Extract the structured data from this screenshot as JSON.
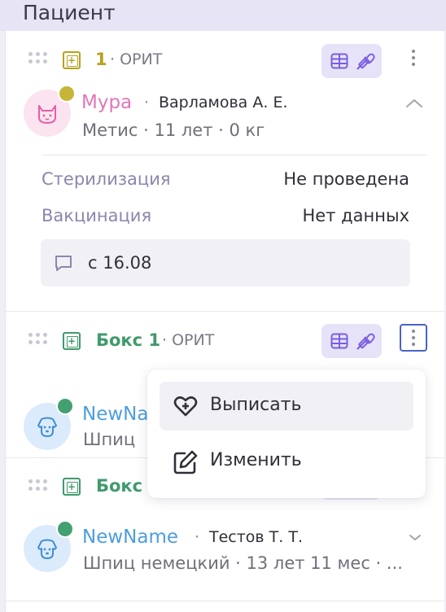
{
  "header": {
    "title": "Пациент"
  },
  "cards": [
    {
      "box_number": "1",
      "department": "ОРИТ",
      "box_color": "#b5a21e",
      "pet_name": "Мура",
      "pet_name_color": "#e276b8",
      "separator": "·",
      "owner": "Варламова А. Е.",
      "pet_info": "Метис · 11 лет · 0 кг",
      "status_color": "#c7b53a",
      "avatar": "cat-icon",
      "expanded": true,
      "details": [
        {
          "label": "Стерилизация",
          "value": "Не проведена"
        },
        {
          "label": "Вакцинация",
          "value": "Нет данных"
        }
      ],
      "note": "с 16.08"
    },
    {
      "box_number": "Бокс 1",
      "department": "ОРИТ",
      "box_color": "#3f9a6c",
      "pet_name": "NewNa",
      "pet_name_color": "#4c9de0",
      "pet_info": "Шпиц",
      "status_color": "#43a070",
      "avatar": "dog-icon"
    },
    {
      "box_number": "Бокс",
      "box_color": "#3f9a6c",
      "pet_name": "NewName",
      "pet_name_color": "#4c9de0",
      "separator": "·",
      "owner": "Тестов Т. Т.",
      "pet_info": "Шпиц немецкий · 13 лет 11 мес · ...",
      "status_color": "#43a070",
      "avatar": "dog-icon"
    }
  ],
  "context_menu": {
    "items": [
      {
        "label": "Выписать",
        "icon": "heart-plus-icon"
      },
      {
        "label": "Изменить",
        "icon": "edit-icon"
      }
    ]
  },
  "colors": {
    "accent": "#7a5ee0",
    "pill_bg": "#e6e3f8",
    "active_border": "#4a63c9"
  }
}
